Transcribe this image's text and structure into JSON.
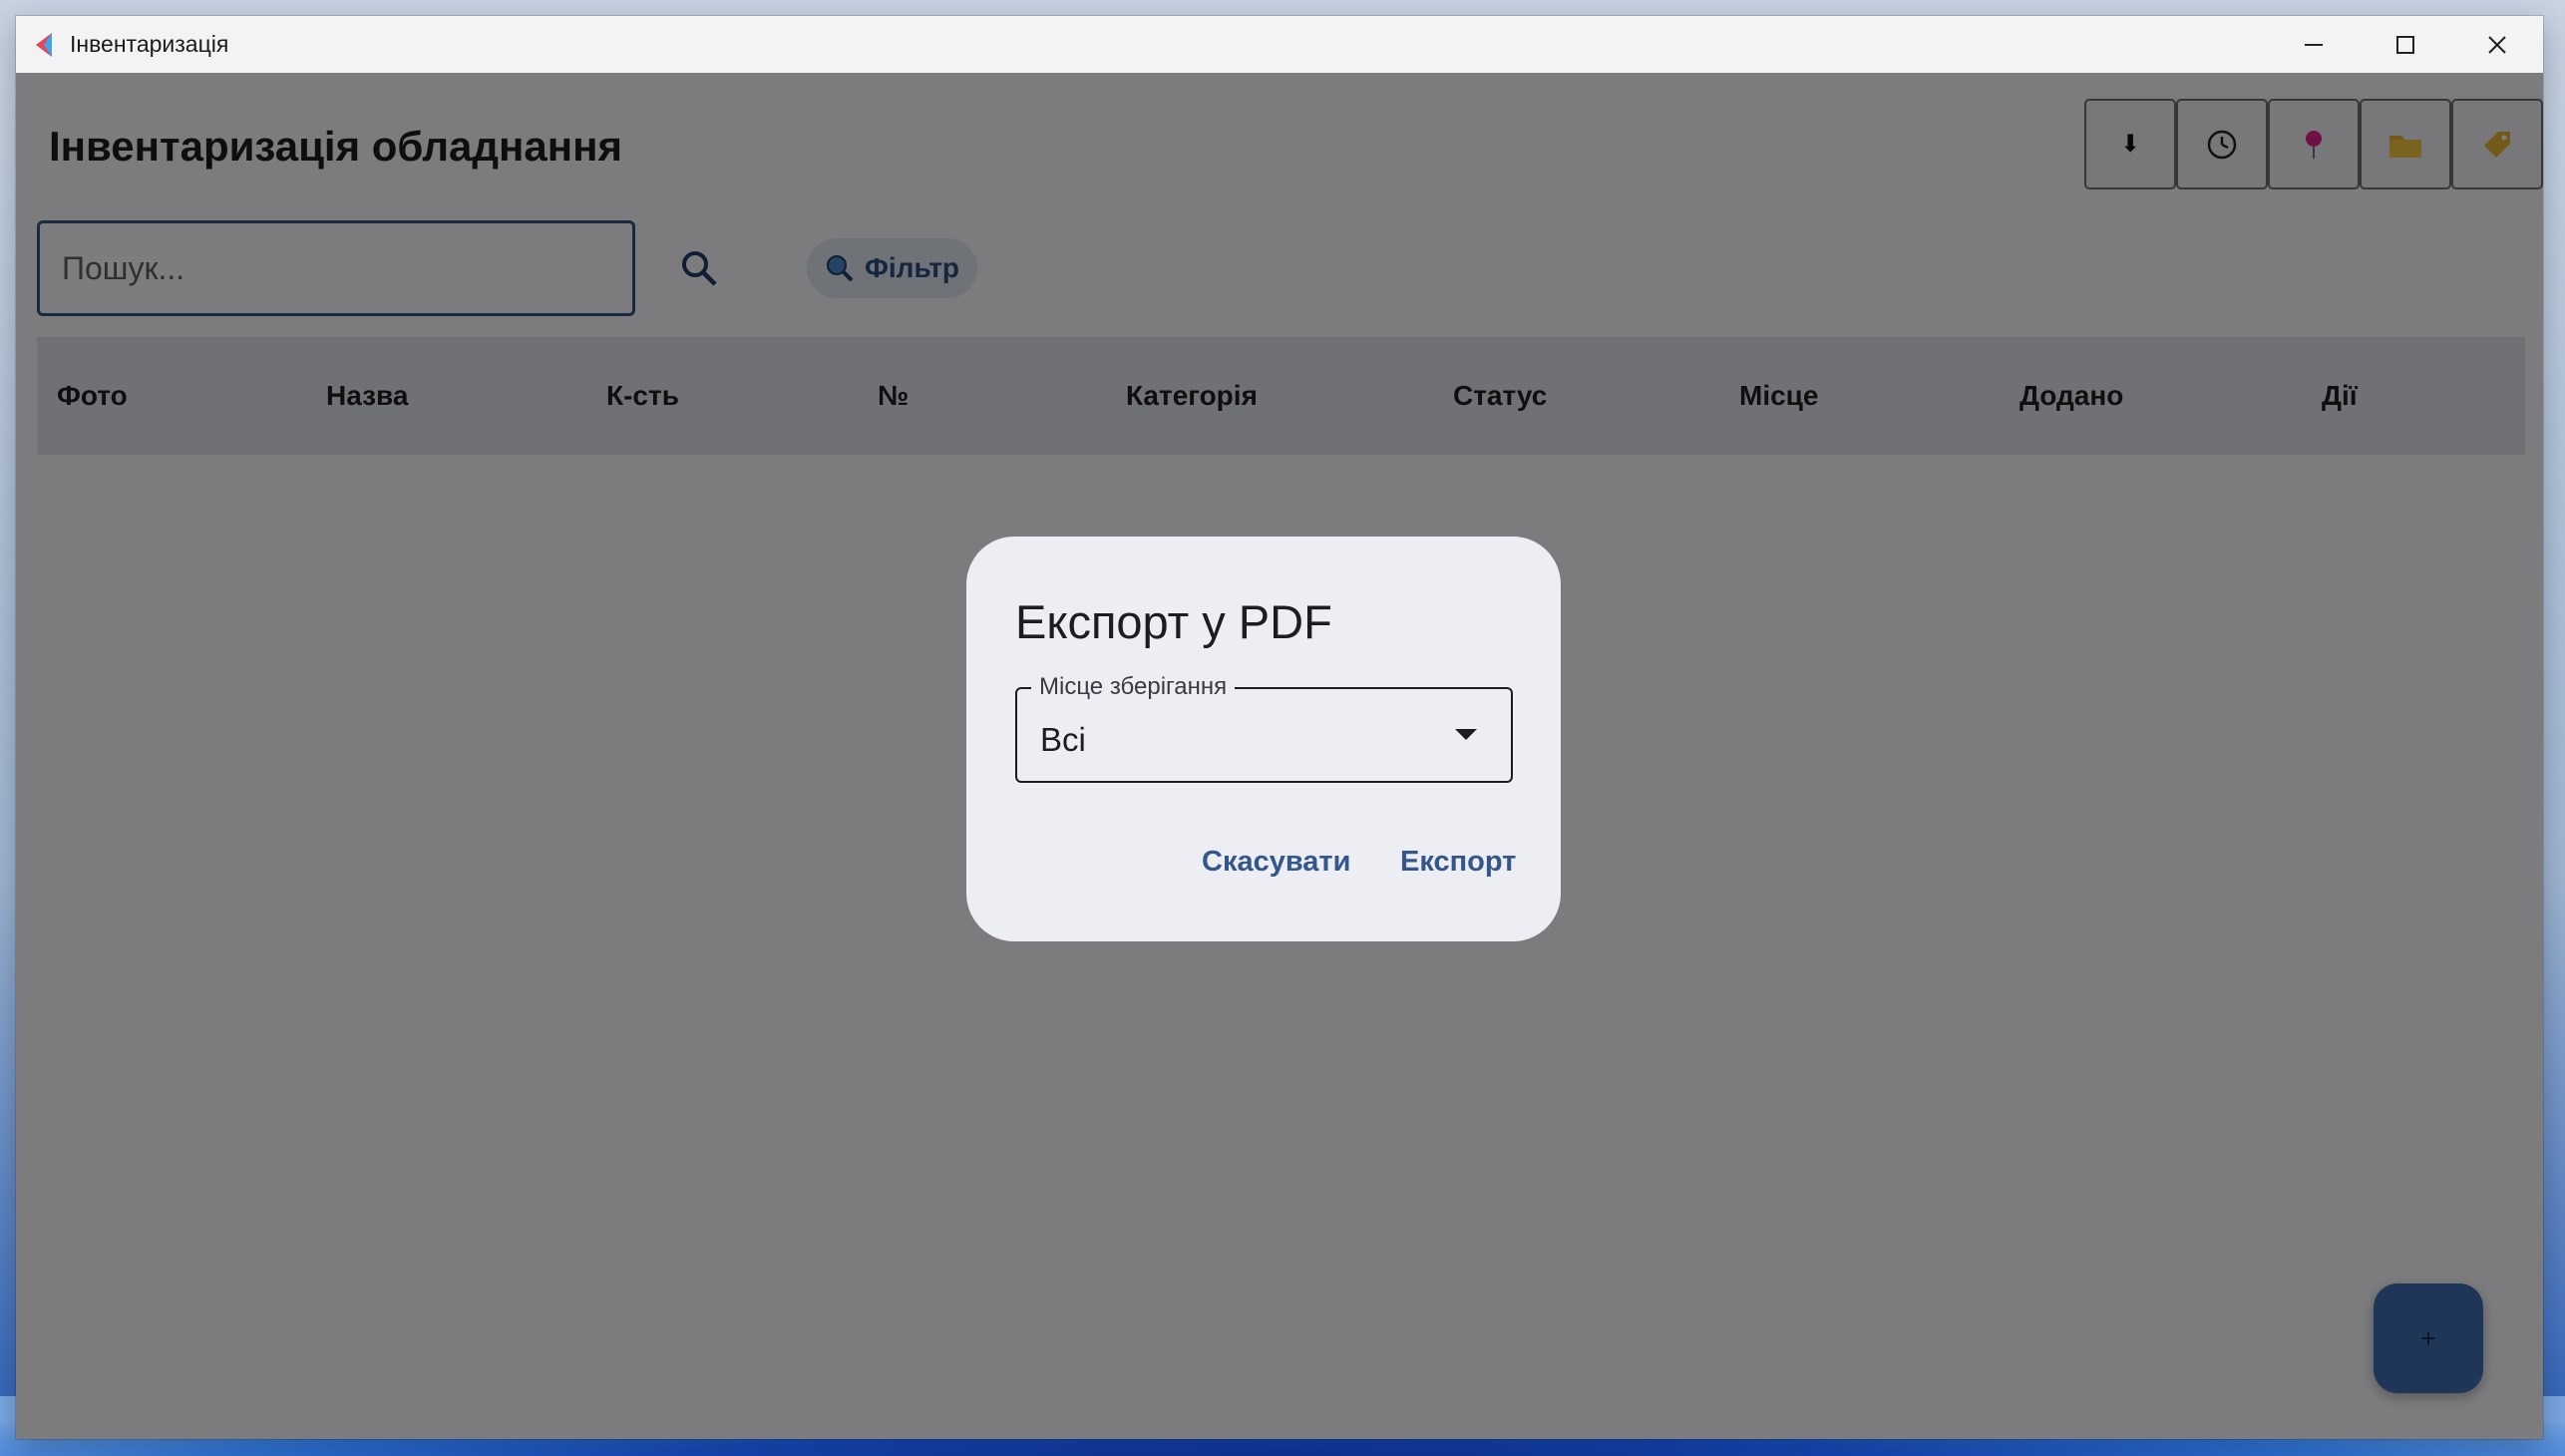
{
  "window": {
    "title": "Інвентаризація"
  },
  "page": {
    "title": "Інвентаризація обладнання"
  },
  "toolbar": {
    "buttons": [
      {
        "icon": "download-arrow-icon",
        "glyph": "⬇"
      },
      {
        "icon": "clock-icon"
      },
      {
        "icon": "pushpin-icon"
      },
      {
        "icon": "folder-icon"
      },
      {
        "icon": "tag-icon"
      }
    ]
  },
  "search": {
    "placeholder": "Пошук...",
    "value": ""
  },
  "filter": {
    "label": "Фільтр"
  },
  "table": {
    "columns": [
      "Фото",
      "Назва",
      "К-сть",
      "№",
      "Категорія",
      "Статус",
      "Місце",
      "Додано",
      "Дії"
    ],
    "rows": []
  },
  "fab": {
    "label": "+"
  },
  "dialog": {
    "title": "Експорт у PDF",
    "field_label": "Місце зберігання",
    "field_value": "Всі",
    "cancel_label": "Скасувати",
    "export_label": "Експорт"
  },
  "colors": {
    "accent": "#35568a",
    "fab": "#3e6db0",
    "scrim": "rgba(0,0,0,0.5)"
  }
}
